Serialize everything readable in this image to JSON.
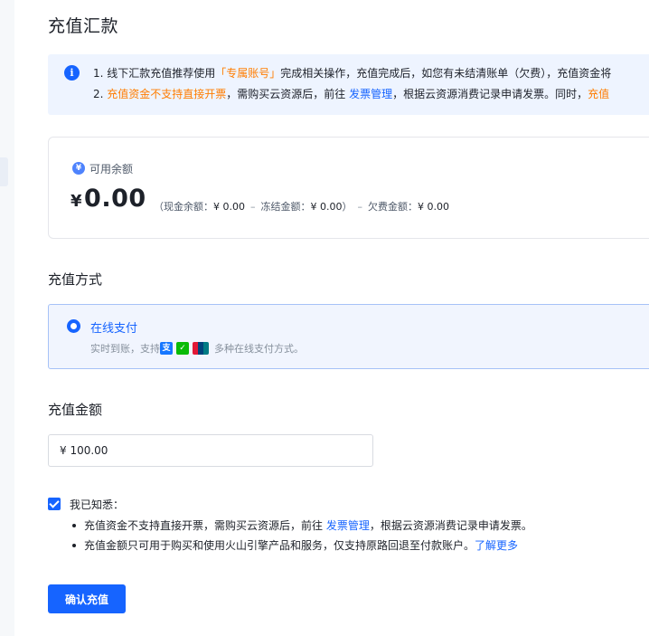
{
  "page": {
    "title": "充值汇款"
  },
  "notice": {
    "icon": "info-icon",
    "line1": {
      "prefix": "1. 线下汇款充值推荐使用",
      "highlight": "「专属账号」",
      "suffix": "完成相关操作，充值完成后，如您有未结清账单（欠费），充值资金将"
    },
    "line2": {
      "num": "2. ",
      "highlight": "充值资金不支持直接开票",
      "mid": "，需购买云资源后，前往 ",
      "link": "发票管理",
      "suffix": "，根据云资源消费记录申请发票。同时，",
      "tail": "充值"
    }
  },
  "balance": {
    "icon": "yen-coin-icon",
    "label": "可用余额",
    "currency": "¥",
    "amount": "0.00",
    "open_paren": "（",
    "cash_label": "现金余额：",
    "cash_value": "¥ 0.00",
    "frozen_label": "冻结金额：",
    "frozen_value": "¥ 0.00",
    "close_paren": "）",
    "owed_label": "欠费金额：",
    "owed_value": "¥ 0.00",
    "dash": "–"
  },
  "method": {
    "section_title": "充值方式",
    "option_label": "在线支付",
    "desc_prefix": "实时到账，支持",
    "desc_suffix": "多种在线支付方式。",
    "icons": [
      "alipay-icon",
      "wechat-pay-icon",
      "unionpay-icon"
    ]
  },
  "amount": {
    "section_title": "充值金额",
    "value": "¥ 100.00"
  },
  "agreement": {
    "checked": true,
    "label": "我已知悉：",
    "item1": {
      "prefix": "充值资金不支持直接开票，需购买云资源后，前往 ",
      "link": "发票管理",
      "suffix": "，根据云资源消费记录申请发票。"
    },
    "item2": {
      "prefix": "充值金额只可用于购买和使用火山引擎产品和服务，仅支持原路回退至付款账户。",
      "link": "了解更多"
    }
  },
  "confirm_button": "确认充值",
  "colors": {
    "primary": "#1664ff",
    "orange": "#ff7d00",
    "notice_bg": "#eef4ff"
  }
}
